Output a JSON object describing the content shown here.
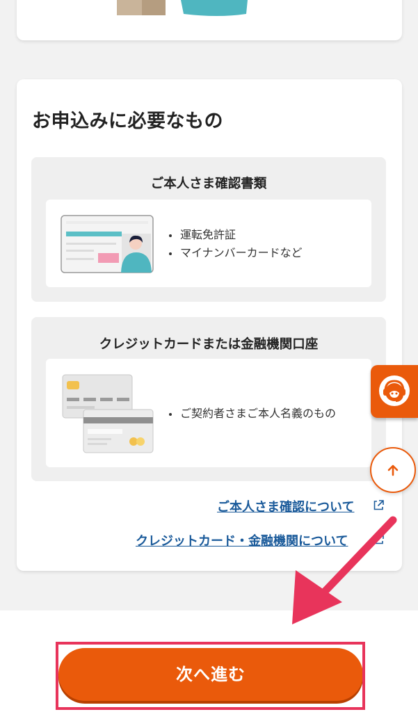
{
  "section": {
    "title": "お申込みに必要なもの"
  },
  "requirements": [
    {
      "title": "ご本人さま確認書類",
      "items": [
        "運転免許証",
        "マイナンバーカードなど"
      ],
      "icon": "id-card-icon"
    },
    {
      "title": "クレジットカードまたは金融機関口座",
      "items": [
        "ご契約者さまご本人名義のもの"
      ],
      "icon": "credit-cards-icon"
    }
  ],
  "links": [
    {
      "label": "ご本人さま確認について",
      "icon": "external-link-icon"
    },
    {
      "label": "クレジットカード・金融機関について",
      "icon": "external-link-icon"
    }
  ],
  "floating": {
    "support_icon": "support-headset-icon",
    "scroll_top_icon": "arrow-up-icon"
  },
  "next_button": {
    "label": "次へ進む"
  },
  "colors": {
    "accent": "#ea5a0b",
    "link": "#1a5a9a",
    "highlight": "#e8345b",
    "teal": "#5bbfc6"
  }
}
